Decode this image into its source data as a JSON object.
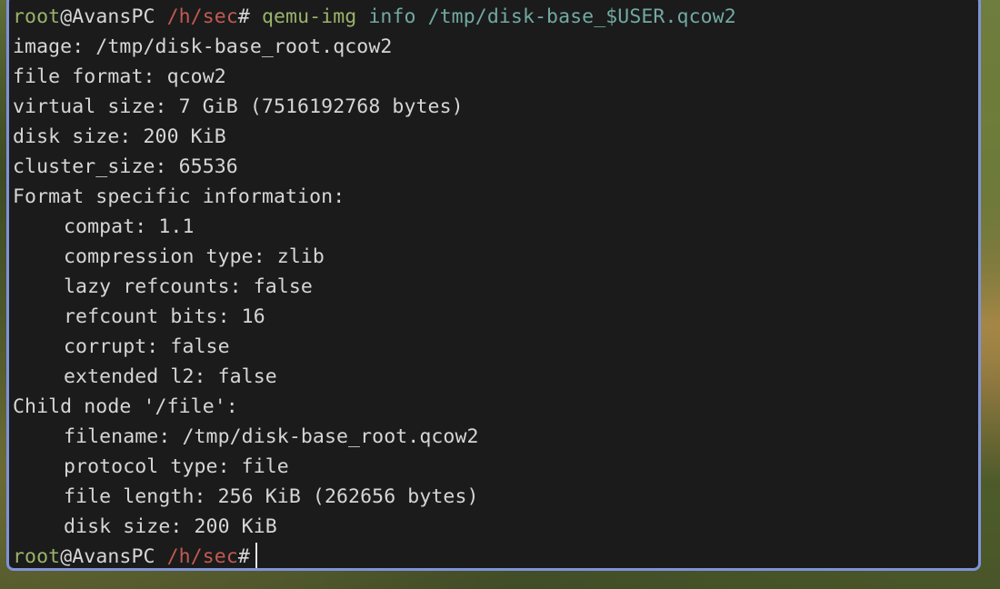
{
  "prompt": {
    "user": "root",
    "at_host": "@AvansPC",
    "cwd": "/h/sec",
    "symbol": "#"
  },
  "command": {
    "program": "qemu-img",
    "subcommand": "info",
    "argument": "/tmp/disk-base_$USER.qcow2"
  },
  "output": {
    "image": "image: /tmp/disk-base_root.qcow2",
    "file_format": "file format: qcow2",
    "virtual_size": "virtual size: 7 GiB (7516192768 bytes)",
    "disk_size": "disk size: 200 KiB",
    "cluster_size": "cluster_size: 65536",
    "format_header": "Format specific information:",
    "compat": "compat: 1.1",
    "compression_type": "compression type: zlib",
    "lazy_refcounts": "lazy refcounts: false",
    "refcount_bits": "refcount bits: 16",
    "corrupt": "corrupt: false",
    "extended_l2": "extended l2: false",
    "child_node": "Child node '/file':",
    "filename": "filename: /tmp/disk-base_root.qcow2",
    "protocol_type": "protocol type: file",
    "file_length": "file length: 256 KiB (262656 bytes)",
    "child_disk_size": "disk size: 200 KiB"
  },
  "colors": {
    "window_border": "#7f93d9",
    "terminal_bg": "#1b1b1b",
    "user_green": "#99b36b",
    "path_red": "#c25a52",
    "arg_teal": "#72a9a2",
    "text": "#d6d6d6"
  }
}
